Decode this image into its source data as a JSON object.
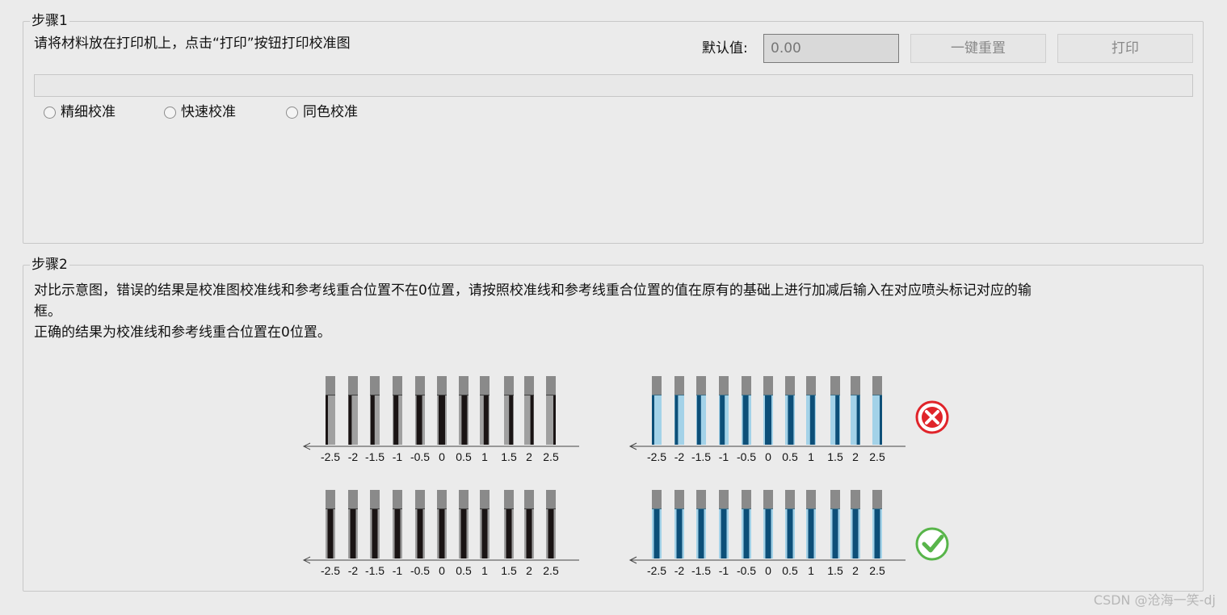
{
  "step1": {
    "title": "步骤1",
    "instruction": "请将材料放在打印机上，点击“打印”按钮打印校准图",
    "default_label": "默认值:",
    "default_value": "0.00",
    "reset_label": "一键重置",
    "print_label": "打印",
    "progress": 0,
    "radios": [
      "精细校准",
      "快速校准",
      "同色校准"
    ]
  },
  "step2": {
    "title": "步骤2",
    "desc_line1": "对比示意图，错误的结果是校准图校准线和参考线重合位置不在0位置，请按照校准线和参考线重合位置的值在原有的基础上进行加减后输入在对应喷头标记对应的输",
    "desc_line2": "框。",
    "desc_line3": "正确的结果为校准线和参考线重合位置在0位置。",
    "ticks": [
      "-2.5",
      "-2",
      "-1.5",
      "-1",
      "-0.5",
      "0",
      "0.5",
      "1",
      "1.5",
      "2",
      "2.5"
    ],
    "colors": {
      "black": "#1a1414",
      "dark_blue": "#0d4f78",
      "light_blue": "#5bb9e6",
      "wrong": "#e0242a",
      "right": "#58b54a"
    },
    "icons": {
      "wrong": "wrong-icon",
      "right": "check-icon"
    }
  },
  "watermark": "CSDN @沧海一笑-dj"
}
